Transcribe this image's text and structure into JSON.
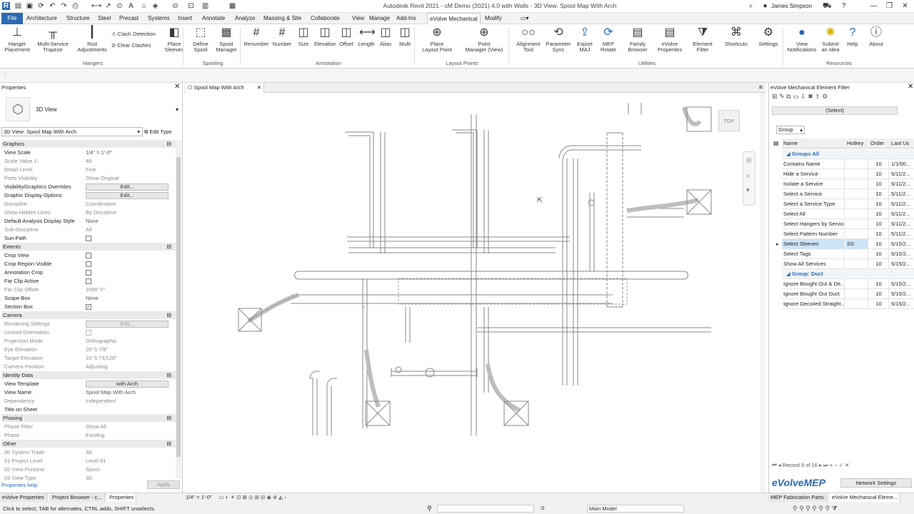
{
  "titlebar": {
    "title": "Autodesk Revit 2021 - cM Demo (2021) 4.0 with Walls - 3D View: Spool Map With Arch",
    "user": "James Simpson"
  },
  "tabs": [
    "File",
    "Architecture",
    "Structure",
    "Steel",
    "Precast",
    "Systems",
    "Insert",
    "Annotate",
    "Analyze",
    "Massing & Site",
    "Collaborate",
    "View",
    "Manage",
    "Add-Ins",
    "eVolve Mechanical",
    "Modify"
  ],
  "ribbon": {
    "buttons": [
      {
        "label": "Hanger\nPlacement",
        "icon": "hanger-icon"
      },
      {
        "label": "Multi-Service\nTrapeze",
        "icon": "trapeze-icon"
      },
      {
        "label": "Rod\nAdjustments",
        "icon": "rod-icon"
      },
      {
        "label": "Place\nSleeves",
        "icon": "sleeve-icon"
      },
      {
        "label": "Define\nSpool",
        "icon": "define-spool-icon"
      },
      {
        "label": "Spool\nManager",
        "icon": "spool-manager-icon"
      },
      {
        "label": "Renumber",
        "icon": "renumber-icon"
      },
      {
        "label": "Number",
        "icon": "number-icon"
      },
      {
        "label": "Size",
        "icon": "size-icon"
      },
      {
        "label": "Elevation",
        "icon": "elevation-icon"
      },
      {
        "label": "Offset",
        "icon": "offset-icon"
      },
      {
        "label": "Length",
        "icon": "length-icon"
      },
      {
        "label": "Alias",
        "icon": "alias-icon"
      },
      {
        "label": "Multi",
        "icon": "multi-icon"
      },
      {
        "label": "Place\nLayout Point",
        "icon": "layout-point-icon"
      },
      {
        "label": "Point\nManager (View)",
        "icon": "point-manager-icon"
      },
      {
        "label": "Alignment\nTool",
        "icon": "alignment-icon"
      },
      {
        "label": "Parameter\nSync",
        "icon": "parameter-sync-icon"
      },
      {
        "label": "Export\nMAJ",
        "icon": "export-icon"
      },
      {
        "label": "MEP\nRotate",
        "icon": "rotate-icon"
      },
      {
        "label": "Family\nBrowser",
        "icon": "family-browser-icon"
      },
      {
        "label": "eVolve\nProperties",
        "icon": "evolve-properties-icon"
      },
      {
        "label": "Element\nFilter",
        "icon": "element-filter-icon"
      },
      {
        "label": "Shortcuts",
        "icon": "shortcuts-icon"
      },
      {
        "label": "Settings",
        "icon": "settings-icon"
      },
      {
        "label": "View\nNotifications",
        "icon": "notifications-icon"
      },
      {
        "label": "Submit\nan Idea",
        "icon": "idea-icon"
      },
      {
        "label": "Help",
        "icon": "help-icon"
      },
      {
        "label": "About",
        "icon": "about-icon"
      }
    ],
    "small_buttons": [
      "Clash Detection",
      "Clear Clashes"
    ],
    "panels": [
      "Hangers",
      "Spooling",
      "Annotation",
      "Layout Points",
      "Utilities",
      "Resources"
    ]
  },
  "properties": {
    "title": "Properties",
    "type_name": "3D View",
    "selector": "3D View: Spool Map With Arch",
    "edit_type": "Edit Type",
    "sections": {
      "graphics": "Graphics",
      "extents": "Extents",
      "camera": "Camera",
      "identity": "Identity Data",
      "phasing": "Phasing",
      "other": "Other"
    },
    "rows": {
      "view_scale": [
        "View Scale",
        "1/4\" = 1'-0\""
      ],
      "scale_value": [
        "Scale Value 1:",
        "48"
      ],
      "detail_level": [
        "Detail Level",
        "Fine"
      ],
      "parts_visibility": [
        "Parts Visibility",
        "Show Original"
      ],
      "vg_overrides": [
        "Visibility/Graphics Overrides",
        "Edit..."
      ],
      "graphic_display": [
        "Graphic Display Options",
        "Edit..."
      ],
      "discipline": [
        "Discipline",
        "Coordination"
      ],
      "hidden_lines": [
        "Show Hidden Lines",
        "By Discipline"
      ],
      "analysis_style": [
        "Default Analysis Display Style",
        "None"
      ],
      "sub_discipline": [
        "Sub-Discipline",
        "All"
      ],
      "sun_path": [
        "Sun Path",
        ""
      ],
      "crop_view": [
        "Crop View",
        ""
      ],
      "crop_visible": [
        "Crop Region Visible",
        ""
      ],
      "annotation_crop": [
        "Annotation Crop",
        ""
      ],
      "far_clip_active": [
        "Far Clip Active",
        ""
      ],
      "far_clip_offset": [
        "Far Clip Offset",
        "1000' 0\""
      ],
      "scope_box": [
        "Scope Box",
        "None"
      ],
      "section_box": [
        "Section Box",
        ""
      ],
      "rendering": [
        "Rendering Settings",
        "Edit..."
      ],
      "locked_orient": [
        "Locked Orientation",
        ""
      ],
      "projection": [
        "Projection Mode",
        "Orthographic"
      ],
      "eye_elev": [
        "Eye Elevation",
        "20' 5 7/8\""
      ],
      "target_elev": [
        "Target Elevation",
        "10' 5 73/128\""
      ],
      "camera_pos": [
        "Camera Position",
        "Adjusting"
      ],
      "view_template": [
        "View Template",
        "with Arch"
      ],
      "view_name": [
        "View Name",
        "Spool Map With Arch"
      ],
      "dependency": [
        "Dependency",
        "Independent"
      ],
      "title_sheet": [
        "Title on Sheet",
        ""
      ],
      "phase_filter": [
        "Phase Filter",
        "Show All"
      ],
      "phase": [
        "Phase",
        "Existing"
      ],
      "system_trade": [
        "00 System Trade",
        "All"
      ],
      "project_level": [
        "01 Project Level",
        "Level 01"
      ],
      "view_purpose": [
        "02 View Purpose",
        "Spool"
      ],
      "view_type": [
        "03 View Type",
        "3D"
      ]
    },
    "help": "Properties help",
    "apply": "Apply"
  },
  "view_tab": "Spool Map With Arch",
  "viewcube_label": "TOP",
  "filter_pane": {
    "title": "eVolve Mechanical Element Filter",
    "select_btn": "(Select)",
    "group_label": "Group",
    "columns": [
      "Name",
      "Hotkey",
      "Order",
      "Last Us"
    ],
    "rows": [
      {
        "name": "Groups All",
        "hot": "",
        "order": "",
        "last": "",
        "type": "group"
      },
      {
        "name": "Contains Name",
        "hot": "",
        "order": "10",
        "last": "1/1/00..."
      },
      {
        "name": "Hide a Service",
        "hot": "",
        "order": "10",
        "last": "5/11/2..."
      },
      {
        "name": "Isolate a Service",
        "hot": "",
        "order": "10",
        "last": "5/11/2..."
      },
      {
        "name": "Select a Service",
        "hot": "",
        "order": "10",
        "last": "5/11/2..."
      },
      {
        "name": "Select a Service Type",
        "hot": "",
        "order": "10",
        "last": "5/11/2..."
      },
      {
        "name": "Select All",
        "hot": "",
        "order": "10",
        "last": "5/11/2..."
      },
      {
        "name": "Select Hangers by Service",
        "hot": "",
        "order": "10",
        "last": "5/11/2..."
      },
      {
        "name": "Select Pattern Number",
        "hot": "",
        "order": "10",
        "last": "5/11/2..."
      },
      {
        "name": "Select Sleeves",
        "hot": "SS",
        "order": "10",
        "last": "5/15/2...",
        "type": "sel"
      },
      {
        "name": "Select Tags",
        "hot": "",
        "order": "10",
        "last": "5/15/2..."
      },
      {
        "name": "Show All Services",
        "hot": "",
        "order": "10",
        "last": "5/15/2..."
      },
      {
        "name": "Group: Duct",
        "hot": "",
        "order": "",
        "last": "",
        "type": "group"
      },
      {
        "name": "Ignore Bought Out & De...",
        "hot": "",
        "order": "10",
        "last": "5/15/2..."
      },
      {
        "name": "Ignore Bought Out Duct",
        "hot": "",
        "order": "10",
        "last": "5/15/2..."
      },
      {
        "name": "Ignore Decoiled Straight...",
        "hot": "",
        "order": "10",
        "last": "5/15/2..."
      }
    ],
    "record": "Record 9 of 16",
    "brand": "eVolveMEP",
    "network": "Network Settings",
    "bottom_tabs": [
      "MEP Fabrication Parts",
      "eVolve Mechanical Eleme..."
    ]
  },
  "status": {
    "hint": "Click to select, TAB for alternates, CTRL adds, SHIFT unselects.",
    "scale": "1/4\" = 1'-0\"",
    "count": ":0",
    "model": "Main Model",
    "prop_tabs": [
      "eVolve Properties",
      "Project Browser - c...",
      "Properties"
    ]
  }
}
